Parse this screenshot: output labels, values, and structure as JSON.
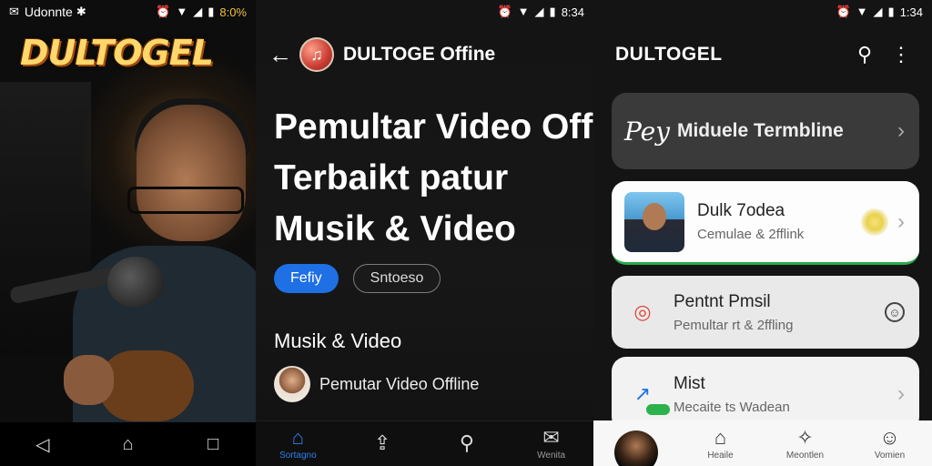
{
  "panel1": {
    "status": {
      "left_text": "Udonnte",
      "battery_text": "8:0%"
    },
    "logo": "DULTOGEL",
    "nav": {
      "back_glyph": "◁",
      "home_glyph": "⌂",
      "recent_glyph": "□"
    }
  },
  "panel2": {
    "status": {
      "time": "8:34"
    },
    "header": {
      "back_glyph": "←",
      "title": "DULTOGE Offine",
      "app_icon_glyph": "♫"
    },
    "hero": {
      "line1": "Pemultar Video Offl",
      "line2": "Terbaikt patur",
      "line3": "Musik & Video"
    },
    "chips": [
      {
        "label": "Fefiy"
      },
      {
        "label": "Sntoeso"
      }
    ],
    "section_title": "Musik & Video",
    "list_item": {
      "label": "Pemutar Video Offline"
    },
    "tabs": [
      {
        "icon": "⌂",
        "label": "Sortagno"
      },
      {
        "icon": "⇪",
        "label": ""
      },
      {
        "icon": "⚲",
        "label": ""
      },
      {
        "icon": "✉",
        "label": "Wenita"
      }
    ]
  },
  "panel3": {
    "status": {
      "time": "1:34"
    },
    "header": {
      "title": "DULTOGEL",
      "search_glyph": "⚲",
      "more_glyph": "⋮"
    },
    "cards": [
      {
        "script": "Pey",
        "title": "Miduele Termbline",
        "chevron": "›"
      },
      {
        "title": "Dulk 7odea",
        "subtitle": "Cemulae & 2fflink",
        "chevron": "›"
      },
      {
        "icon": "◎",
        "title": "Pentnt Pmsil",
        "subtitle": "Pemultar rt & 2ffling",
        "end": "☺"
      },
      {
        "icon": "↗",
        "title": "Mist",
        "subtitle": "Mecaite ts Wadean",
        "chevron": "›"
      }
    ],
    "tabs": [
      {
        "icon": "",
        "label": ""
      },
      {
        "icon": "⌂",
        "label": "Heaile"
      },
      {
        "icon": "✧",
        "label": "Meontlen"
      },
      {
        "icon": "☺",
        "label": "Vomien"
      }
    ]
  },
  "colors": {
    "accent_blue": "#1f6fe5",
    "green": "#2bb24a",
    "logo_gold": "#ffd76a"
  }
}
